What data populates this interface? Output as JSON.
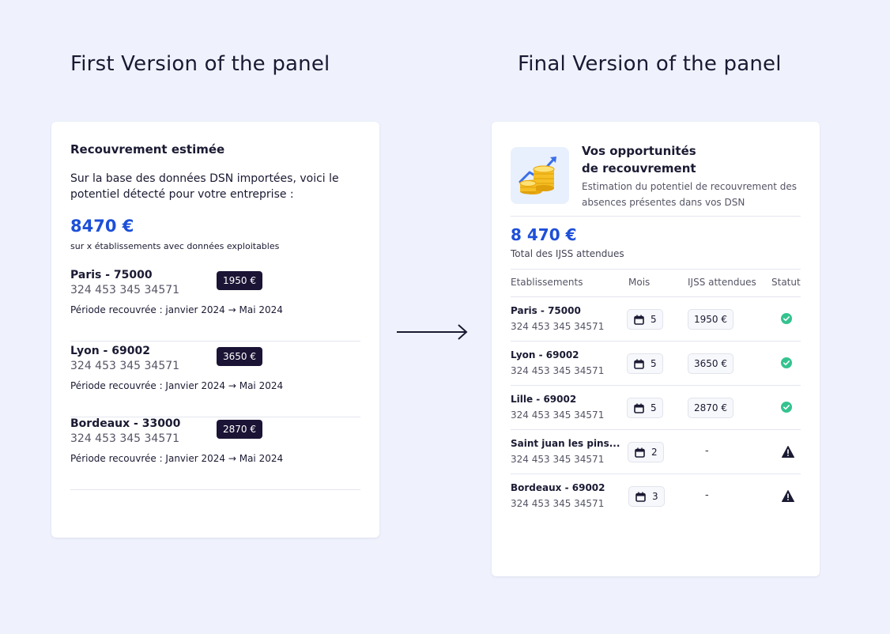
{
  "headings": {
    "left": "First Version of the panel",
    "right": "Final Version of the panel"
  },
  "first_panel": {
    "title": "Recouvrement estimée",
    "description": "Sur la base des données DSN importées, voici le potentiel détecté pour votre entreprise :",
    "amount": "8470 €",
    "subtitle": "sur x établissements avec données exploitables",
    "items": [
      {
        "name": "Paris - 75000",
        "siret": "324 453 345 34571",
        "amount": "1950 €",
        "period": "Période recouvrée : janvier 2024 → Mai 2024"
      },
      {
        "name": "Lyon - 69002",
        "siret": "324 453 345 34571",
        "amount": "3650 €",
        "period": "Période recouvrée : Janvier 2024 → Mai 2024"
      },
      {
        "name": "Bordeaux - 33000",
        "siret": "324 453 345 34571",
        "amount": "2870 €",
        "period": "Période recouvrée : Janvier 2024 → Mai 2024"
      }
    ]
  },
  "final_panel": {
    "title_line1": "Vos opportunités",
    "title_line2": "de recouvrement",
    "description": "Estimation du potentiel de recouvrement des absences présentes dans vos DSN",
    "amount": "8 470 €",
    "subtitle": "Total des IJSS attendues",
    "columns": [
      "Etablissements",
      "Mois",
      "IJSS attendues",
      "Statut"
    ],
    "rows": [
      {
        "name": "Paris - 75000",
        "siret": "324 453 345 34571",
        "mois": "5",
        "ijss": "1950 €",
        "status": "ok"
      },
      {
        "name": "Lyon - 69002",
        "siret": "324 453 345 34571",
        "mois": "5",
        "ijss": "3650 €",
        "status": "ok"
      },
      {
        "name": "Lille - 69002",
        "siret": "324 453 345 34571",
        "mois": "5",
        "ijss": "2870 €",
        "status": "ok"
      },
      {
        "name": "Saint juan les pins...",
        "siret": "324 453 345 34571",
        "mois": "2",
        "ijss": "-",
        "status": "warning"
      },
      {
        "name": "Bordeaux - 69002",
        "siret": "324 453 345 34571",
        "mois": "3",
        "ijss": "-",
        "status": "warning"
      }
    ]
  },
  "colors": {
    "background": "#eff2fc",
    "accent_blue": "#1d4fd8",
    "badge_dark": "#1b1435",
    "status_ok": "#34c38f",
    "status_warning": "#1a1a33"
  },
  "icons": {
    "transition": "arrow-right-icon",
    "opportunity": "coins-growth-icon",
    "calendar": "calendar-icon",
    "ok": "check-circle-icon",
    "warning": "warning-triangle-icon"
  }
}
